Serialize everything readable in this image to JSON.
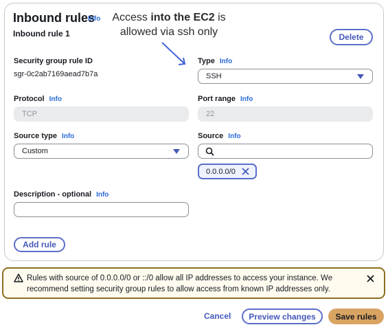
{
  "panel": {
    "title": "Inbound rules",
    "title_info": "Info",
    "subtitle": "Inbound rule 1",
    "delete_label": "Delete"
  },
  "annotation": {
    "prefix": "Access ",
    "bold": "into the EC2",
    "suffix": " is",
    "line2": "allowed via ssh only"
  },
  "fields": {
    "sg_rule_id": {
      "label": "Security group rule ID",
      "value": "sgr-0c2ab7169aead7b7a"
    },
    "type": {
      "label": "Type",
      "info": "Info",
      "value": "SSH"
    },
    "protocol": {
      "label": "Protocol",
      "info": "Info",
      "value": "TCP"
    },
    "port_range": {
      "label": "Port range",
      "info": "Info",
      "value": "22"
    },
    "source_type": {
      "label": "Source type",
      "info": "Info",
      "value": "Custom"
    },
    "source": {
      "label": "Source",
      "info": "Info",
      "value": "",
      "token": "0.0.0.0/0"
    },
    "description": {
      "label": "Description - optional",
      "info": "Info",
      "value": ""
    }
  },
  "add_rule_label": "Add rule",
  "warning": {
    "text": "Rules with source of 0.0.0.0/0 or ::/0 allow all IP addresses to access your instance. We recommend setting security group rules to allow access from known IP addresses only."
  },
  "footer": {
    "cancel_label": "Cancel",
    "preview_label": "Preview changes",
    "save_label": "Save rules"
  },
  "colors": {
    "accent": "#5a6ec9",
    "link": "#2a6bd6",
    "warning_border": "#8c6e1e",
    "primary_button": "#d9a462"
  },
  "icons": [
    "caret-down-icon",
    "search-icon",
    "close-icon",
    "warning-icon",
    "arrow-annotation-icon"
  ]
}
